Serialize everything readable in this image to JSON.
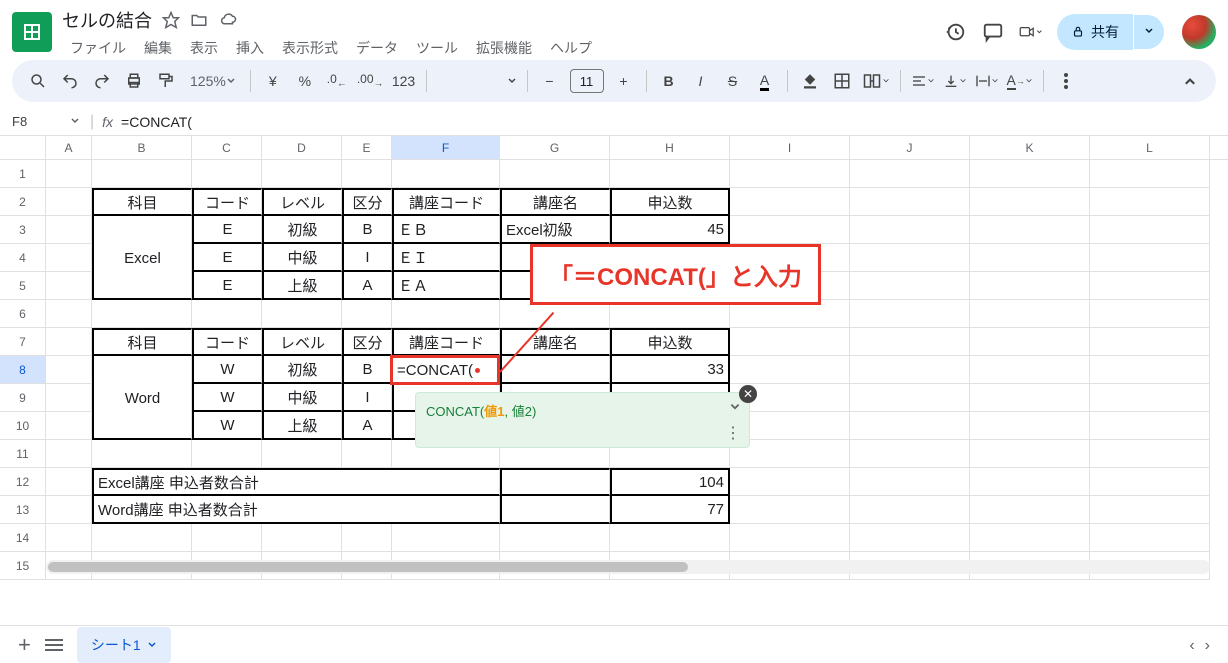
{
  "doc": {
    "title": "セルの結合"
  },
  "menus": {
    "file": "ファイル",
    "edit": "編集",
    "view": "表示",
    "insert": "挿入",
    "format": "表示形式",
    "data": "データ",
    "tools": "ツール",
    "ext": "拡張機能",
    "help": "ヘルプ"
  },
  "toolbar": {
    "zoom": "125%",
    "yen": "¥",
    "pct": "%",
    "dec0": ".0",
    "dec00": ".00",
    "num": "123",
    "font_size": "11"
  },
  "share": {
    "label": "共有"
  },
  "formula_bar": {
    "cell": "F8",
    "value": "=CONCAT("
  },
  "columns": [
    "A",
    "B",
    "C",
    "D",
    "E",
    "F",
    "G",
    "H",
    "I",
    "J",
    "K",
    "L"
  ],
  "rows": [
    "1",
    "2",
    "3",
    "4",
    "5",
    "6",
    "7",
    "8",
    "9",
    "10",
    "11",
    "12",
    "13",
    "14",
    "15"
  ],
  "t1": {
    "h": {
      "b": "科目",
      "c": "コード",
      "d": "レベル",
      "e": "区分",
      "f": "講座コード",
      "g": "講座名",
      "h": "申込数"
    },
    "r1": {
      "b": "Excel",
      "c": "E",
      "d": "初級",
      "e": "B",
      "f": "ＥＢ",
      "g": "Excel初級",
      "h": "45"
    },
    "r2": {
      "c": "E",
      "d": "中級",
      "e": "I",
      "f": "ＥＩ"
    },
    "r3": {
      "c": "E",
      "d": "上級",
      "e": "A",
      "f": "ＥＡ"
    }
  },
  "t2": {
    "h": {
      "b": "科目",
      "c": "コード",
      "d": "レベル",
      "e": "区分",
      "f": "講座コード",
      "g": "講座名",
      "h": "申込数"
    },
    "r1": {
      "b": "Word",
      "c": "W",
      "d": "初級",
      "e": "B",
      "h": "33"
    },
    "r2": {
      "c": "W",
      "d": "中級",
      "e": "I"
    },
    "r3": {
      "c": "W",
      "d": "上級",
      "e": "A"
    }
  },
  "totals": {
    "r1_label": "Excel講座 申込者数合計",
    "r1_val": "104",
    "r2_label": "Word講座 申込者数合計",
    "r2_val": "77"
  },
  "edit": {
    "value": "=CONCAT("
  },
  "hint": {
    "fn": "CONCAT(",
    "arg1": "値1",
    "sep": ", ",
    "arg2": "値2",
    "close": ")"
  },
  "callout": {
    "text": "「＝CONCAT(」と入力"
  },
  "sheet": {
    "name": "シート1"
  }
}
